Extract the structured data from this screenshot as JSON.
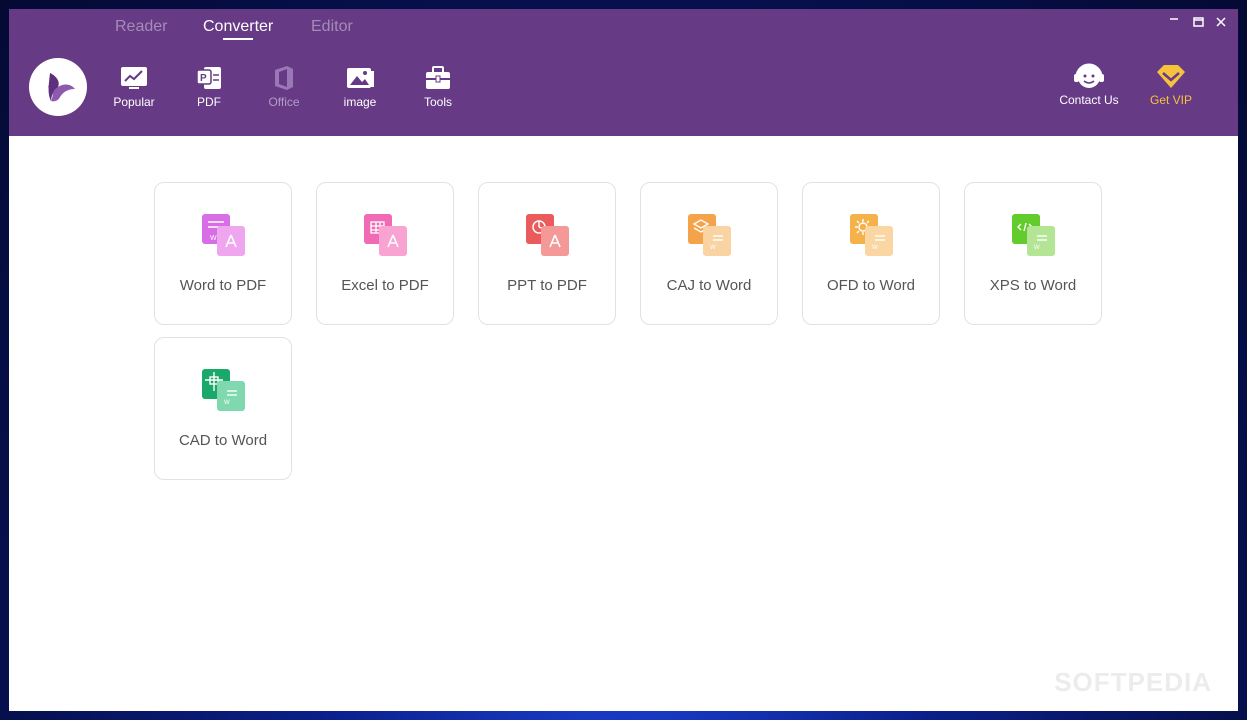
{
  "top_tabs": [
    "Reader",
    "Converter",
    "Editor"
  ],
  "active_tab": "Converter",
  "toolbar": [
    {
      "label": "Popular",
      "icon": "chart-icon"
    },
    {
      "label": "PDF",
      "icon": "pdf-icon"
    },
    {
      "label": "Office",
      "icon": "office-icon"
    },
    {
      "label": "image",
      "icon": "image-icon"
    },
    {
      "label": "Tools",
      "icon": "toolbox-icon"
    }
  ],
  "contact": {
    "label": "Contact Us",
    "icon": "headset-icon"
  },
  "vip": {
    "label": "Get VIP",
    "icon": "diamond-icon",
    "color": "#f6c23e"
  },
  "cards": [
    {
      "label": "Word to PDF",
      "color": "#d86ee6",
      "color_light": "#f0a6ee"
    },
    {
      "label": "Excel to PDF",
      "color": "#f06bb4",
      "color_light": "#f8a3d1"
    },
    {
      "label": "PPT to PDF",
      "color": "#ec5b5b",
      "color_light": "#f49898"
    },
    {
      "label": "CAJ to Word",
      "color": "#f5a34a",
      "color_light": "#fad3a3"
    },
    {
      "label": "OFD to Word",
      "color": "#f5b14a",
      "color_light": "#fad6a3"
    },
    {
      "label": "XPS to Word",
      "color": "#62cc2c",
      "color_light": "#b3e595"
    },
    {
      "label": "CAD to Word",
      "color": "#1aa86b",
      "color_light": "#7fd8ae"
    }
  ],
  "colors": {
    "header": "#663a85",
    "accent": "#ffffff"
  },
  "watermark": "SOFTPEDIA"
}
